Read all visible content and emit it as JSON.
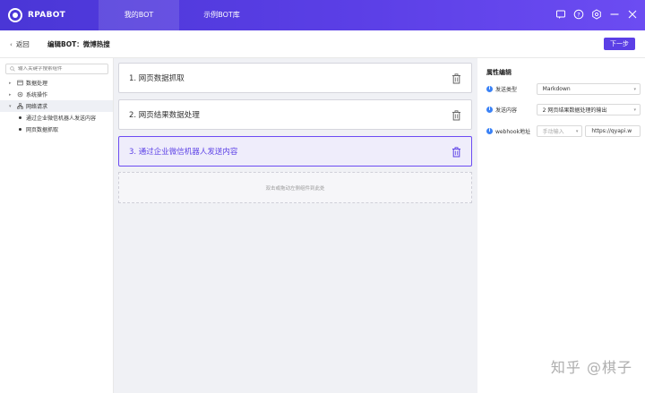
{
  "app": {
    "brand": "RPABOT"
  },
  "nav": {
    "tabs": [
      "我的BOT",
      "示例BOT库"
    ]
  },
  "header": {
    "back_label": "返回",
    "title": "编辑BOT：微博热搜",
    "next_label": "下一步"
  },
  "sidebar": {
    "search_placeholder": "输入关键字搜索组件",
    "items": [
      {
        "label": "数据处理",
        "icon": "data-icon"
      },
      {
        "label": "系统操作",
        "icon": "gear-icon"
      },
      {
        "label": "网络请求",
        "icon": "network-icon"
      }
    ],
    "children": [
      "通过企业微信机器人发送内容",
      "网页数据抓取"
    ]
  },
  "canvas": {
    "steps": [
      "1. 网页数据抓取",
      "2. 网页结果数据处理",
      "3. 通过企业微信机器人发送内容"
    ],
    "dropzone_text": "双击或拖动左侧组件到此处"
  },
  "properties": {
    "title": "属性编辑",
    "send_type_label": "发送类型",
    "send_type_value": "Markdown",
    "send_content_label": "发送内容",
    "send_content_value": "2 网页结果数据处理的输出",
    "webhook_label": "webhook地址",
    "webhook_mode": "手动输入",
    "webhook_value": "https://qyapi.w"
  },
  "watermark": "知乎 @棋子",
  "colors": {
    "primary": "#5b3fe6",
    "info": "#3b82f6"
  }
}
